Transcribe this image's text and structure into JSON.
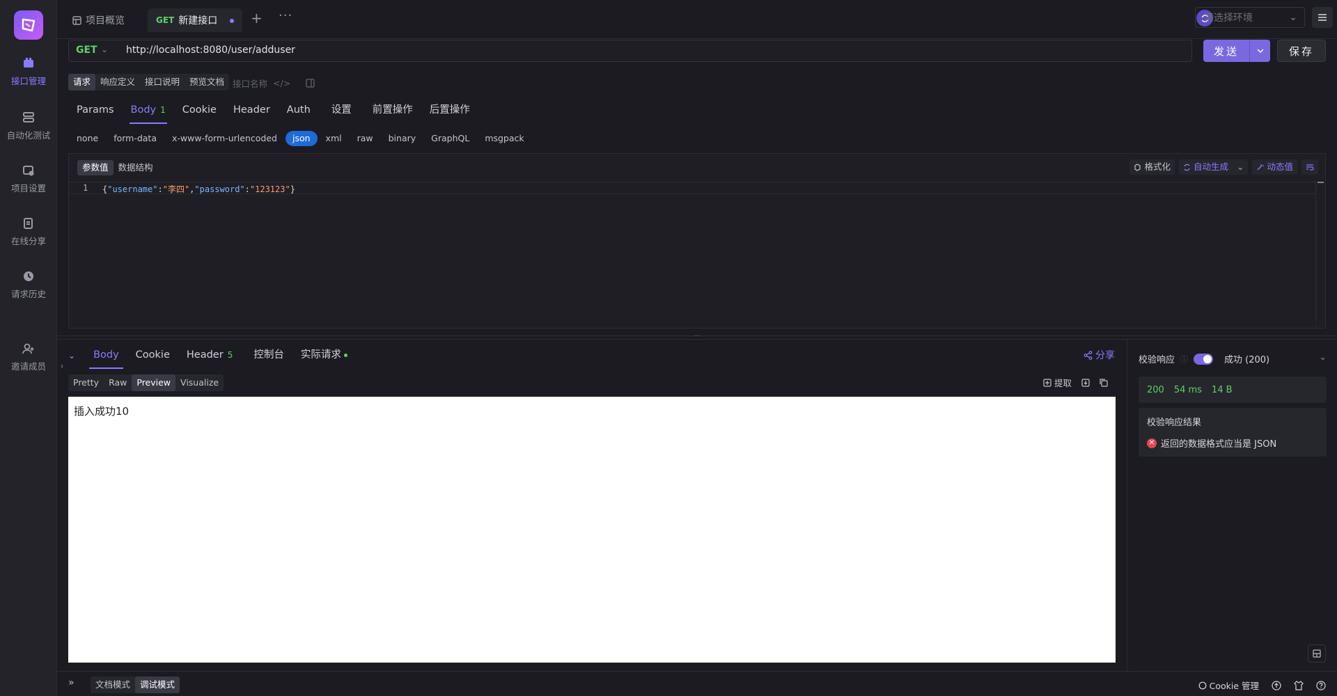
{
  "sidebar": {
    "items": [
      {
        "label": "接口管理",
        "icon": "api-icon"
      },
      {
        "label": "自动化测试",
        "icon": "automation-icon"
      },
      {
        "label": "项目设置",
        "icon": "settings-icon"
      },
      {
        "label": "在线分享",
        "icon": "share-doc-icon"
      },
      {
        "label": "请求历史",
        "icon": "history-icon"
      },
      {
        "label": "邀请成员",
        "icon": "invite-icon"
      }
    ]
  },
  "tabs": {
    "overview": "项目概览",
    "active_method": "GET",
    "active_title": "新建接口"
  },
  "env": {
    "placeholder": "请选择环境"
  },
  "request": {
    "method": "GET",
    "url": "http://localhost:8080/user/adduser",
    "send": "发送",
    "save": "保存"
  },
  "subtabs": [
    "请求",
    "响应定义",
    "接口说明",
    "预览文档"
  ],
  "subtab_extra": "接口名称",
  "param_tabs": {
    "params": "Params",
    "body": "Body",
    "body_count": "1",
    "cookie": "Cookie",
    "header": "Header",
    "auth": "Auth",
    "settings": "设置",
    "pre": "前置操作",
    "post": "后置操作"
  },
  "body_types": [
    "none",
    "form-data",
    "x-www-form-urlencoded",
    "json",
    "xml",
    "raw",
    "binary",
    "GraphQL",
    "msgpack"
  ],
  "editor": {
    "tabs": [
      "参数值",
      "数据结构"
    ],
    "tools": {
      "format": "格式化",
      "auto": "自动生成",
      "dynamic": "动态值"
    },
    "line_no": "1",
    "code": {
      "k1": "\"username\"",
      "v1": "\"李四\"",
      "k2": "\"password\"",
      "v2": "\"123123\""
    }
  },
  "response": {
    "tabs": {
      "body": "Body",
      "cookie": "Cookie",
      "header": "Header",
      "header_count": "5",
      "console": "控制台",
      "actual": "实际请求"
    },
    "share": "分享",
    "formats": [
      "Pretty",
      "Raw",
      "Preview",
      "Visualize"
    ],
    "extract": "提取",
    "preview_text": "插入成功10"
  },
  "validation": {
    "label": "校验响应",
    "status": "成功 (200)",
    "code": "200",
    "time": "54 ms",
    "size": "14 B",
    "result_title": "校验响应结果",
    "error": "返回的数据格式应当是 JSON"
  },
  "bottom": {
    "modes": [
      "文档模式",
      "调试模式"
    ],
    "cookie": "Cookie 管理"
  },
  "colors": {
    "accent": "#8b7bff",
    "success": "#5fcf6a",
    "json_active": "#1e6ad8",
    "error": "#e5484d"
  }
}
